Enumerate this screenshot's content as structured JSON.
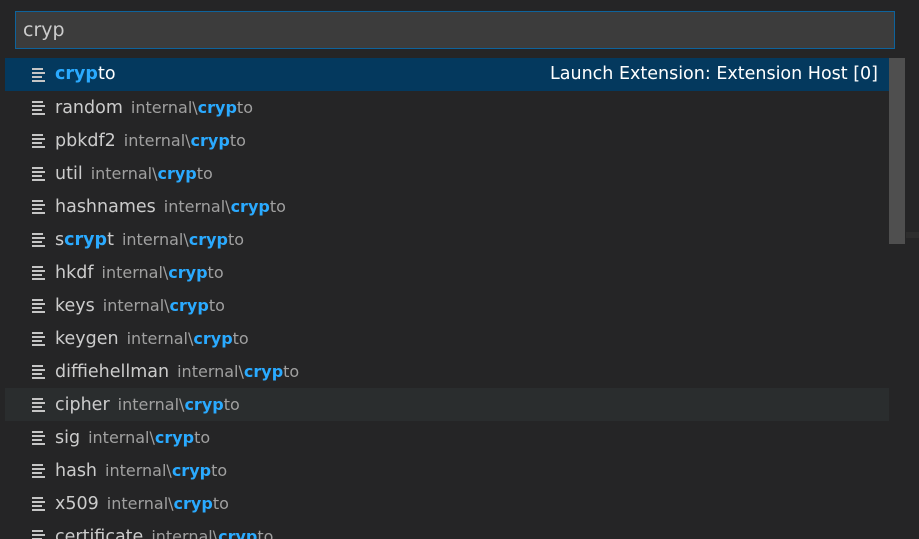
{
  "search": {
    "value": "cryp"
  },
  "results": [
    {
      "hl_before": "",
      "hl": "cryp",
      "hl_after": "to",
      "desc_prefix": "",
      "desc_hl": "",
      "desc_suffix": "",
      "detail": "Launch Extension: Extension Host [0]",
      "state": "selected"
    },
    {
      "hl_before": "random",
      "hl": "",
      "hl_after": "",
      "desc_prefix": "internal\\",
      "desc_hl": "cryp",
      "desc_suffix": "to",
      "detail": "",
      "state": ""
    },
    {
      "hl_before": "pbkdf2",
      "hl": "",
      "hl_after": "",
      "desc_prefix": "internal\\",
      "desc_hl": "cryp",
      "desc_suffix": "to",
      "detail": "",
      "state": ""
    },
    {
      "hl_before": "util",
      "hl": "",
      "hl_after": "",
      "desc_prefix": "internal\\",
      "desc_hl": "cryp",
      "desc_suffix": "to",
      "detail": "",
      "state": ""
    },
    {
      "hl_before": "hashnames",
      "hl": "",
      "hl_after": "",
      "desc_prefix": "internal\\",
      "desc_hl": "cryp",
      "desc_suffix": "to",
      "detail": "",
      "state": ""
    },
    {
      "hl_before": "s",
      "hl": "cryp",
      "hl_after": "t",
      "desc_prefix": "internal\\",
      "desc_hl": "cryp",
      "desc_suffix": "to",
      "detail": "",
      "state": ""
    },
    {
      "hl_before": "hkdf",
      "hl": "",
      "hl_after": "",
      "desc_prefix": "internal\\",
      "desc_hl": "cryp",
      "desc_suffix": "to",
      "detail": "",
      "state": ""
    },
    {
      "hl_before": "keys",
      "hl": "",
      "hl_after": "",
      "desc_prefix": "internal\\",
      "desc_hl": "cryp",
      "desc_suffix": "to",
      "detail": "",
      "state": ""
    },
    {
      "hl_before": "keygen",
      "hl": "",
      "hl_after": "",
      "desc_prefix": "internal\\",
      "desc_hl": "cryp",
      "desc_suffix": "to",
      "detail": "",
      "state": ""
    },
    {
      "hl_before": "diffiehellman",
      "hl": "",
      "hl_after": "",
      "desc_prefix": "internal\\",
      "desc_hl": "cryp",
      "desc_suffix": "to",
      "detail": "",
      "state": ""
    },
    {
      "hl_before": "cipher",
      "hl": "",
      "hl_after": "",
      "desc_prefix": "internal\\",
      "desc_hl": "cryp",
      "desc_suffix": "to",
      "detail": "",
      "state": "hovered"
    },
    {
      "hl_before": "sig",
      "hl": "",
      "hl_after": "",
      "desc_prefix": "internal\\",
      "desc_hl": "cryp",
      "desc_suffix": "to",
      "detail": "",
      "state": ""
    },
    {
      "hl_before": "hash",
      "hl": "",
      "hl_after": "",
      "desc_prefix": "internal\\",
      "desc_hl": "cryp",
      "desc_suffix": "to",
      "detail": "",
      "state": ""
    },
    {
      "hl_before": "x509",
      "hl": "",
      "hl_after": "",
      "desc_prefix": "internal\\",
      "desc_hl": "cryp",
      "desc_suffix": "to",
      "detail": "",
      "state": ""
    },
    {
      "hl_before": "certificate",
      "hl": "",
      "hl_after": "",
      "desc_prefix": "internal\\",
      "desc_hl": "cryp",
      "desc_suffix": "to",
      "detail": "",
      "state": ""
    }
  ],
  "icon": "symbol-text-icon",
  "colors": {
    "highlight": "#2aaaff",
    "selected_bg": "#04395e",
    "focus_border": "#0e639c"
  }
}
